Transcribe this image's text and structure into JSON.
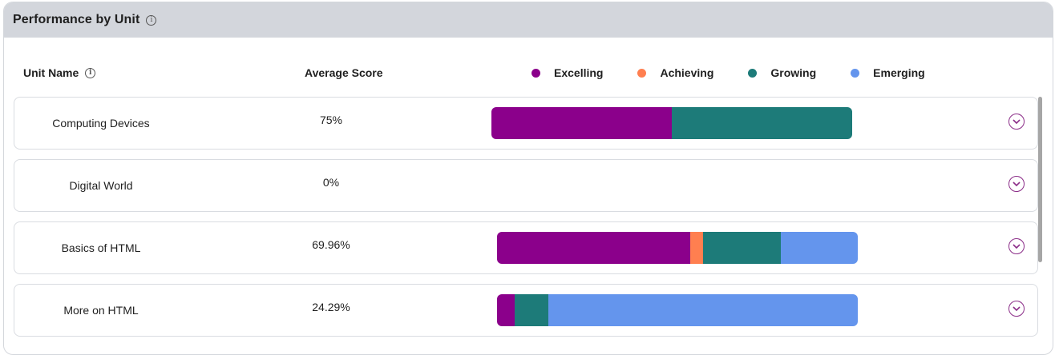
{
  "panel": {
    "title": "Performance by Unit",
    "info_glyph": "i"
  },
  "columns": {
    "unit_name": "Unit Name",
    "average_score": "Average Score"
  },
  "legend": [
    {
      "label": "Excelling",
      "color": "#8b008b"
    },
    {
      "label": "Achieving",
      "color": "#ff7f50"
    },
    {
      "label": "Growing",
      "color": "#1d7b79"
    },
    {
      "label": "Emerging",
      "color": "#6495ed"
    }
  ],
  "units": [
    {
      "name": "Computing Devices",
      "score": "75%",
      "distribution": {
        "excelling": 0.5,
        "achieving": 0,
        "growing": 0.5,
        "emerging": 0
      }
    },
    {
      "name": "Digital World",
      "score": "0%",
      "distribution": {
        "excelling": 0,
        "achieving": 0,
        "growing": 0,
        "emerging": 0
      }
    },
    {
      "name": "Basics of HTML",
      "score": "69.96%",
      "distribution": {
        "excelling": 0.535,
        "achieving": 0.036,
        "growing": 0.216,
        "emerging": 0.213
      }
    },
    {
      "name": "More on HTML",
      "score": "24.29%",
      "distribution": {
        "excelling": 0.049,
        "achieving": 0,
        "growing": 0.093,
        "emerging": 0.858
      }
    }
  ]
}
